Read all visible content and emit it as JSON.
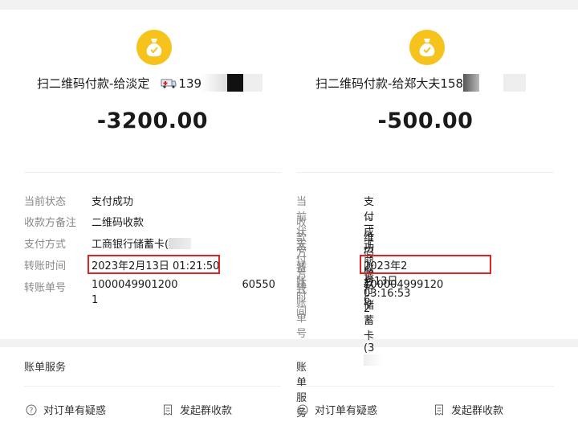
{
  "colors": {
    "coin": "#f6c21c",
    "highlight": "#e02424",
    "label": "#888888"
  },
  "receipts": [
    {
      "payee_prefix": "扫二维码付款-给淡定",
      "payee_phone_visible": "139",
      "amount": "-3200.00",
      "details": {
        "status_label": "当前状态",
        "status_value": "支付成功",
        "remark_label": "收款方备注",
        "remark_value": "二维码收款",
        "method_label": "支付方式",
        "method_value": "工商银行储蓄卡(",
        "time_label": "转账时间",
        "time_value": "2023年2月13日 01:21:50",
        "order_label": "转账单号",
        "order_value_line1": "1000049901200",
        "order_value_tail": "60550",
        "order_value_line2": "1"
      },
      "service_title": "账单服务",
      "question_button": "对订单有疑惑",
      "group_button": "发起群收款"
    },
    {
      "payee_prefix": "扫二维码付款-给郑大夫158",
      "payee_phone_visible": "",
      "amount": "-500.00",
      "details": {
        "status_label": "当前状态",
        "status_value": "支付成功",
        "remark_label": "收款方备注",
        "remark_value": "二维码收款",
        "method_label": "支付方式",
        "method_value": "工商银行储蓄卡(3",
        "time_label": "转账时间",
        "time_value": "2023年2月13日 03:16:53",
        "order_label": "转账单号",
        "order_value_line1": "100004999120",
        "order_value_tail": "2",
        "order_value_line2": "6"
      },
      "service_title": "账单服务",
      "question_button": "对订单有疑惑",
      "group_button": "发起群收款"
    }
  ]
}
